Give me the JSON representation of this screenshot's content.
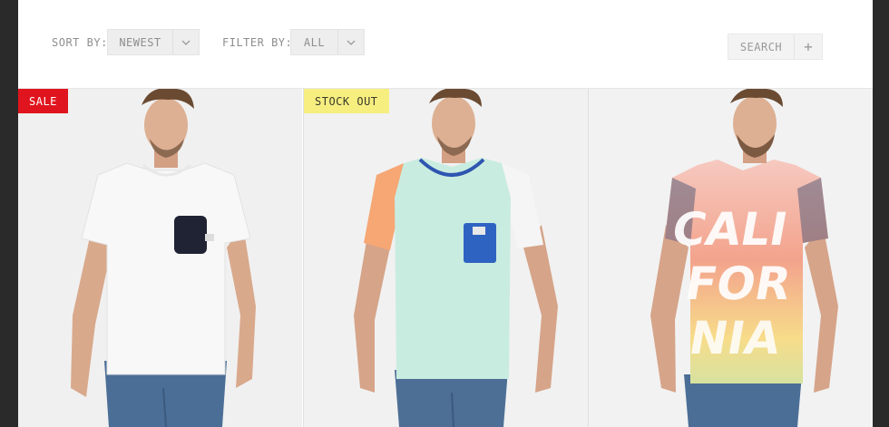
{
  "toolbar": {
    "sort_label": "SORT BY:",
    "sort_value": "NEWEST",
    "filter_label": "FILTER BY:",
    "filter_value": "ALL",
    "search_label": "SEARCH",
    "search_icon": "plus-icon"
  },
  "products": [
    {
      "badge": "SALE",
      "badge_color": "#e0141e",
      "shirt_color": "#f8f8f8",
      "pocket_color": "#1f2333"
    },
    {
      "badge": "STOCK OUT",
      "badge_color": "#f7ee80",
      "shirt_color": "#c9ece0",
      "pocket_color": "#2f63c2"
    },
    {
      "badge": "",
      "shirt_color": "#f3c9bf",
      "print_text": "CALI FOR NIA"
    }
  ],
  "colors": {
    "accent_sale": "#e0141e",
    "accent_stock": "#f7ee80",
    "background": "#2a2a2a"
  }
}
